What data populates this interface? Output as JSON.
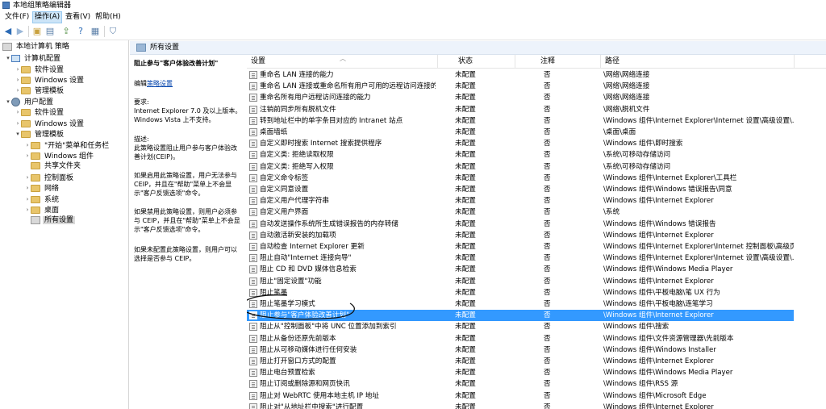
{
  "window": {
    "title": "本地组策略编辑器"
  },
  "menu": [
    {
      "label": "文件(F)",
      "active": false
    },
    {
      "label": "操作(A)",
      "active": true
    },
    {
      "label": "查看(V)",
      "active": false
    },
    {
      "label": "帮助(H)",
      "active": false
    }
  ],
  "toolbar": {
    "icons": [
      "back-arrow-icon",
      "forward-arrow-icon",
      "up-folder-icon",
      "show-tree-icon",
      "export-icon",
      "help-icon",
      "properties-icon",
      "filter-icon"
    ]
  },
  "tree": [
    {
      "label": "本地计算机 策略",
      "level": 0,
      "expander": "",
      "icon": "policy"
    },
    {
      "label": "计算机配置",
      "level": 1,
      "expander": "▾",
      "icon": "pc"
    },
    {
      "label": "软件设置",
      "level": 2,
      "expander": "›",
      "icon": "folder"
    },
    {
      "label": "Windows 设置",
      "level": 2,
      "expander": "›",
      "icon": "folder"
    },
    {
      "label": "管理模板",
      "level": 2,
      "expander": "›",
      "icon": "folder"
    },
    {
      "label": "用户配置",
      "level": 1,
      "expander": "▾",
      "icon": "gear"
    },
    {
      "label": "软件设置",
      "level": 2,
      "expander": "›",
      "icon": "folder"
    },
    {
      "label": "Windows 设置",
      "level": 2,
      "expander": "›",
      "icon": "folder"
    },
    {
      "label": "管理模板",
      "level": 2,
      "expander": "▾",
      "icon": "folder"
    },
    {
      "label": "\"开始\"菜单和任务栏",
      "level": 3,
      "expander": "›",
      "icon": "folder"
    },
    {
      "label": "Windows 组件",
      "level": 3,
      "expander": "›",
      "icon": "folder"
    },
    {
      "label": "共享文件夹",
      "level": 3,
      "expander": "",
      "icon": "folder"
    },
    {
      "label": "控制面板",
      "level": 3,
      "expander": "›",
      "icon": "folder"
    },
    {
      "label": "网络",
      "level": 3,
      "expander": "›",
      "icon": "folder"
    },
    {
      "label": "系统",
      "level": 3,
      "expander": "›",
      "icon": "folder"
    },
    {
      "label": "桌面",
      "level": 3,
      "expander": "›",
      "icon": "folder"
    },
    {
      "label": "所有设置",
      "level": 3,
      "expander": "",
      "icon": "policy",
      "selected": true
    }
  ],
  "header": {
    "title": "所有设置"
  },
  "description": {
    "title": "阻止参与\"客户体验改善计划\"",
    "edit_prefix": "编辑",
    "edit_link": "策略设置",
    "requirements": "要求:\nInternet Explorer 7.0 及以上版本。Windows Vista 上不支持。",
    "description": "描述:\n此策略设置阻止用户参与客户体验改善计划(CEIP)。",
    "enabled": "如果启用此策略设置，用户无法参与 CEIP，并且在\"帮助\"菜单上不会显示\"客户反馈选项\"命令。",
    "disabled": "如果禁用此策略设置，则用户必须参与 CEIP，并且在\"帮助\"菜单上不会显示\"客户反馈选项\"命令。",
    "not_configured": "如果未配置此策略设置，则用户可以选择是否参与 CEIP。"
  },
  "columns": {
    "setting": "设置",
    "state": "状态",
    "comment": "注释",
    "path": "路径"
  },
  "rows": [
    {
      "setting": "重命名 LAN 连接的能力",
      "state": "未配置",
      "comment": "否",
      "path": "\\网络\\网络连接"
    },
    {
      "setting": "重命名 LAN 连接或重命名所有用户可用的远程访问连接的...",
      "state": "未配置",
      "comment": "否",
      "path": "\\网络\\网络连接"
    },
    {
      "setting": "重命名所有用户远程访问连接的能力",
      "state": "未配置",
      "comment": "否",
      "path": "\\网络\\网络连接"
    },
    {
      "setting": "注销前同步所有脱机文件",
      "state": "未配置",
      "comment": "否",
      "path": "\\网络\\脱机文件"
    },
    {
      "setting": "转到地址栏中的单字条目对应的 Intranet 站点",
      "state": "未配置",
      "comment": "否",
      "path": "\\Windows 组件\\Internet Explorer\\Internet 设置\\高级设置\\..."
    },
    {
      "setting": "桌面墙纸",
      "state": "未配置",
      "comment": "否",
      "path": "\\桌面\\桌面"
    },
    {
      "setting": "自定义即时搜索 Internet 搜索提供程序",
      "state": "未配置",
      "comment": "否",
      "path": "\\Windows 组件\\即时搜索"
    },
    {
      "setting": "自定义类: 拒绝读取权限",
      "state": "未配置",
      "comment": "否",
      "path": "\\系统\\可移动存储访问"
    },
    {
      "setting": "自定义类: 拒绝写入权限",
      "state": "未配置",
      "comment": "否",
      "path": "\\系统\\可移动存储访问"
    },
    {
      "setting": "自定义命令标签",
      "state": "未配置",
      "comment": "否",
      "path": "\\Windows 组件\\Internet Explorer\\工具栏"
    },
    {
      "setting": "自定义同意设置",
      "state": "未配置",
      "comment": "否",
      "path": "\\Windows 组件\\Windows 错误报告\\同意"
    },
    {
      "setting": "自定义用户代理字符串",
      "state": "未配置",
      "comment": "否",
      "path": "\\Windows 组件\\Internet Explorer"
    },
    {
      "setting": "自定义用户界面",
      "state": "未配置",
      "comment": "否",
      "path": "\\系统"
    },
    {
      "setting": "自动发送操作系统所生成错误报告的内存转储",
      "state": "未配置",
      "comment": "否",
      "path": "\\Windows 组件\\Windows 错误报告"
    },
    {
      "setting": "自动激活新安装的加载项",
      "state": "未配置",
      "comment": "否",
      "path": "\\Windows 组件\\Internet Explorer"
    },
    {
      "setting": "自动检查 Internet Explorer 更新",
      "state": "未配置",
      "comment": "否",
      "path": "\\Windows 组件\\Internet Explorer\\Internet 控制面板\\高级页"
    },
    {
      "setting": "阻止自动\"Internet 连接向导\"",
      "state": "未配置",
      "comment": "否",
      "path": "\\Windows 组件\\Internet Explorer\\Internet 设置\\高级设置\\..."
    },
    {
      "setting": "阻止 CD 和 DVD 媒体信息检索",
      "state": "未配置",
      "comment": "否",
      "path": "\\Windows 组件\\Windows Media Player"
    },
    {
      "setting": "阻止\"固定设置\"功能",
      "state": "未配置",
      "comment": "否",
      "path": "\\Windows 组件\\Internet Explorer"
    },
    {
      "setting": "阻止笔墨",
      "state": "未配置",
      "comment": "否",
      "path": "\\Windows 组件\\平板电脑\\笔 UX 行为"
    },
    {
      "setting": "阻止笔墨学习模式",
      "state": "未配置",
      "comment": "否",
      "path": "\\Windows 组件\\平板电脑\\连笔学习"
    },
    {
      "setting": "阻止参与\"客户体验改善计划\"",
      "state": "未配置",
      "comment": "否",
      "path": "\\Windows 组件\\Internet Explorer",
      "selected": true
    },
    {
      "setting": "阻止从\"控制面板\"中将 UNC 位置添加到索引",
      "state": "未配置",
      "comment": "否",
      "path": "\\Windows 组件\\搜索"
    },
    {
      "setting": "阻止从备份还原先前版本",
      "state": "未配置",
      "comment": "否",
      "path": "\\Windows 组件\\文件资源管理器\\先前版本"
    },
    {
      "setting": "阻止从可移动媒体进行任何安装",
      "state": "未配置",
      "comment": "否",
      "path": "\\Windows 组件\\Windows Installer"
    },
    {
      "setting": "阻止打开窗口方式的配置",
      "state": "未配置",
      "comment": "否",
      "path": "\\Windows 组件\\Internet Explorer"
    },
    {
      "setting": "阻止电台预置检索",
      "state": "未配置",
      "comment": "否",
      "path": "\\Windows 组件\\Windows Media Player"
    },
    {
      "setting": "阻止订阅或删除源和网页快讯",
      "state": "未配置",
      "comment": "否",
      "path": "\\Windows 组件\\RSS 源"
    },
    {
      "setting": "阻止对 WebRTC 使用本地主机 IP 地址",
      "state": "未配置",
      "comment": "否",
      "path": "\\Windows 组件\\Microsoft Edge"
    },
    {
      "setting": "阻止对\"从地址栏中搜索\"进行配置",
      "state": "未配置",
      "comment": "否",
      "path": "\\Windows 组件\\Internet Explorer"
    }
  ]
}
